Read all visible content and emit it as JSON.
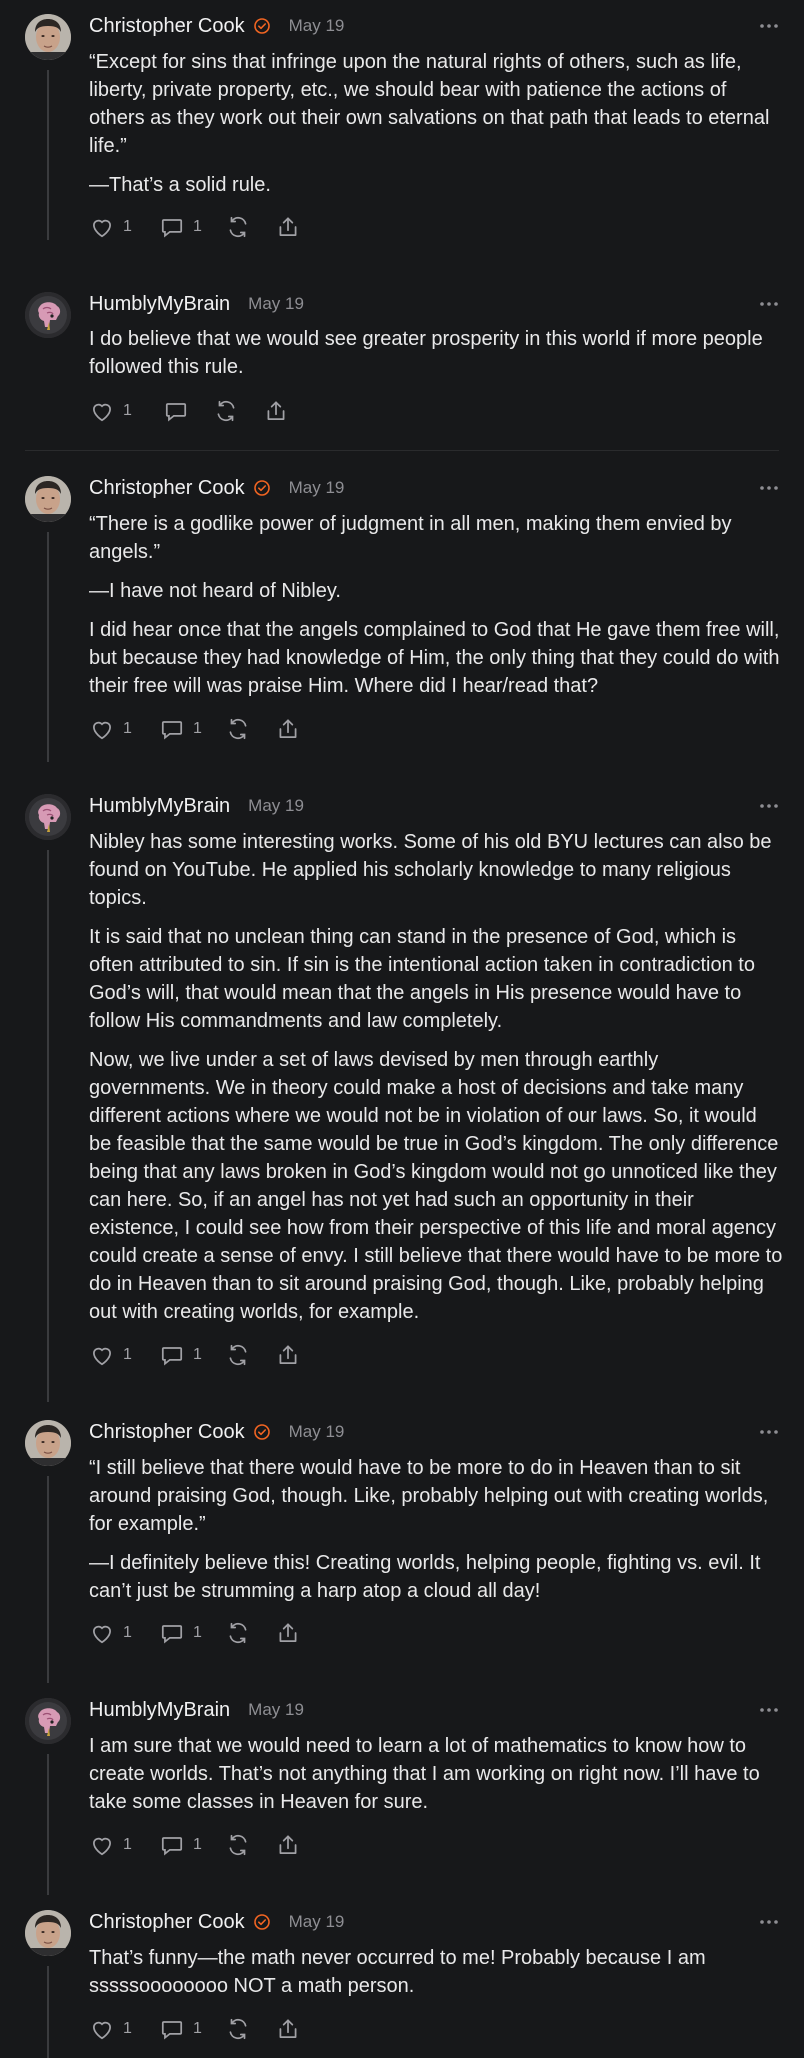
{
  "theme": {
    "background": "#17181a",
    "accent": "#f26522",
    "muted": "#8e8e93"
  },
  "posts": [
    {
      "author": "Christopher Cook",
      "verified": true,
      "date": "May 19",
      "avatar": "cook",
      "paragraphs": [
        "“Except for sins that infringe upon the natural rights of others, such as life, liberty, private property, etc., we should bear with patience the actions of others as they work out their own salvations on that path that leads to eternal life.”",
        "—That’s a solid rule."
      ],
      "likes": "1",
      "replies": "1"
    },
    {
      "author": "HumblyMyBrain",
      "verified": false,
      "date": "May 19",
      "avatar": "brain",
      "paragraphs": [
        "I do believe that we would see greater prosperity in this world if more people followed this rule."
      ],
      "likes": "1",
      "replies": ""
    },
    {
      "author": "Christopher Cook",
      "verified": true,
      "date": "May 19",
      "avatar": "cook",
      "paragraphs": [
        "“There is a godlike power of judgment in all men, making them envied by angels.”",
        "—I have not heard of Nibley.",
        "I did hear once that the angels complained to God that He gave them free will, but because they had knowledge of Him, the only thing that they could do with their free will was praise Him. Where did I hear/read that?"
      ],
      "likes": "1",
      "replies": "1"
    },
    {
      "author": "HumblyMyBrain",
      "verified": false,
      "date": "May 19",
      "avatar": "brain",
      "paragraphs": [
        "Nibley has some interesting works. Some of his old BYU lectures can also be found on YouTube. He applied his scholarly knowledge to many religious topics.",
        "It is said that no unclean thing can stand in the presence of God, which is often attributed to sin. If sin is the intentional action taken in contradiction to God’s will, that would mean that the angels in His presence would have to follow His commandments and law completely.",
        "Now, we live under a set of laws devised by men through earthly governments. We in theory could make a host of decisions and take many different actions where we would not be in violation of our laws. So, it would be feasible that the same would be true in God’s kingdom. The only difference being that any laws broken in God’s kingdom would not go unnoticed like they can here. So, if an angel has not yet had such an opportunity in their existence, I could see how from their perspective of this life and moral agency could create a sense of envy. I still believe that there would have to be more to do in Heaven than to sit around praising God, though. Like, probably helping out with creating worlds, for example."
      ],
      "likes": "1",
      "replies": "1"
    },
    {
      "author": "Christopher Cook",
      "verified": true,
      "date": "May 19",
      "avatar": "cook",
      "paragraphs": [
        "“I still believe that there would have to be more to do in Heaven than to sit around praising God, though. Like, probably helping out with creating worlds, for example.”",
        "—I definitely believe this! Creating worlds, helping people, fighting vs. evil. It can’t just be strumming a harp atop a cloud all day!"
      ],
      "likes": "1",
      "replies": "1"
    },
    {
      "author": "HumblyMyBrain",
      "verified": false,
      "date": "May 19",
      "avatar": "brain",
      "paragraphs": [
        "I am sure that we would need to learn a lot of mathematics to know how to create worlds. That’s not anything that I am working on right now. I’ll have to take some classes in Heaven for sure."
      ],
      "likes": "1",
      "replies": "1"
    },
    {
      "author": "Christopher Cook",
      "verified": true,
      "date": "May 19",
      "avatar": "cook",
      "paragraphs": [
        "That’s funny—the math never occurred to me! Probably because I am sssssoooooooo NOT a math person."
      ],
      "likes": "1",
      "replies": "1"
    }
  ]
}
